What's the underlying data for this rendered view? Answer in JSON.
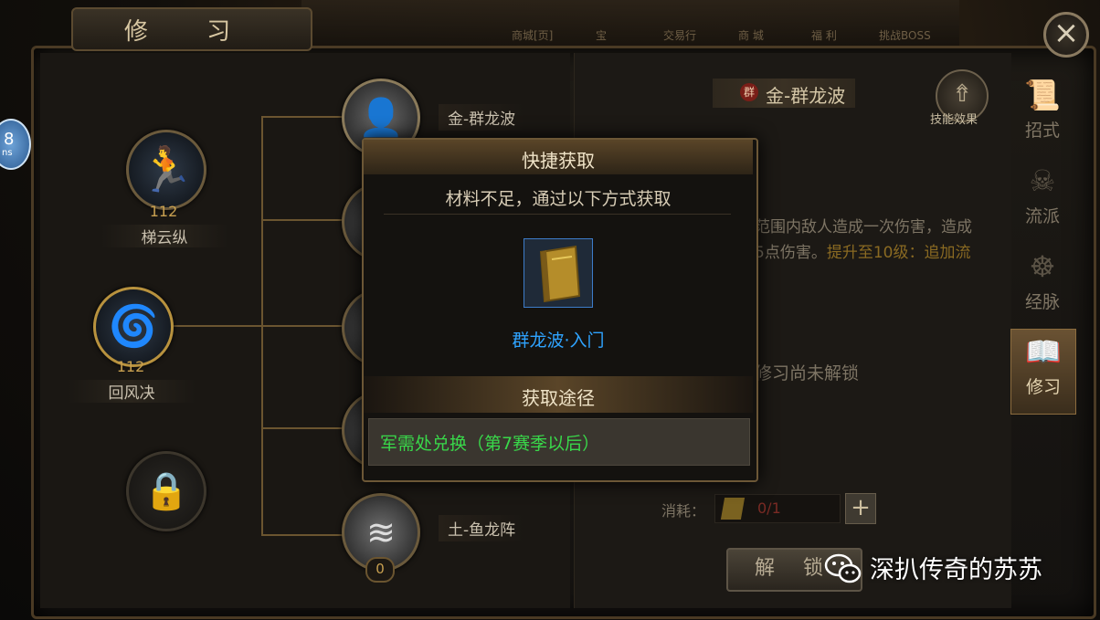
{
  "window": {
    "title": "修 习"
  },
  "top_nav": [
    "商城[页]",
    "宝",
    "交易行",
    "商 城",
    "福 利",
    "挑战BOSS"
  ],
  "badge": {
    "text": "8",
    "sub": "ns"
  },
  "left_tree": {
    "skills": [
      {
        "name": "梯云纵",
        "level": "112",
        "icon": "running-figure-icon"
      },
      {
        "name": "回风决",
        "level": "112",
        "icon": "spinning-strike-icon"
      }
    ],
    "locked_slot_icon": "lock-icon",
    "branches": [
      {
        "name": "金-群龙波",
        "icon": "silhouette-icon"
      },
      {
        "name": "土-鱼龙阵",
        "icon": "swirl-icon",
        "level": "0"
      }
    ]
  },
  "right_panel": {
    "skill_tag": "群",
    "skill_name": "金-群龙波",
    "effect_button": "技能效果",
    "desc_line1": "范围内敌人造成一次伤害，造成",
    "desc_line2_a": "5点伤害。",
    "desc_line2_b": "提升至10级：追加流",
    "lock_text": "修习尚未解锁",
    "cost_label": "消耗：",
    "cost_value": "0/1",
    "plus": "+",
    "unlock_button": "解 锁"
  },
  "side_tabs": [
    {
      "label": "招式",
      "icon": "scroll-icon"
    },
    {
      "label": "流派",
      "icon": "skull-icon"
    },
    {
      "label": "经脉",
      "icon": "meditation-icon"
    },
    {
      "label": "修习",
      "icon": "book-scroll-icon",
      "active": true
    }
  ],
  "popup": {
    "title": "快捷获取",
    "subtitle": "材料不足，通过以下方式获取",
    "item_name": "群龙波·入门",
    "item_icon": "golden-book-icon",
    "route_header": "获取途径",
    "route_text": "军需处兑换（第7赛季以后）"
  },
  "watermark": {
    "text": "深扒传奇的苏苏",
    "icon": "wechat-icon"
  },
  "colors": {
    "item_name": "#2fa3ff",
    "route_text": "#39d84a",
    "highlight": "#c8a030",
    "cost_value": "#c23a2e"
  }
}
